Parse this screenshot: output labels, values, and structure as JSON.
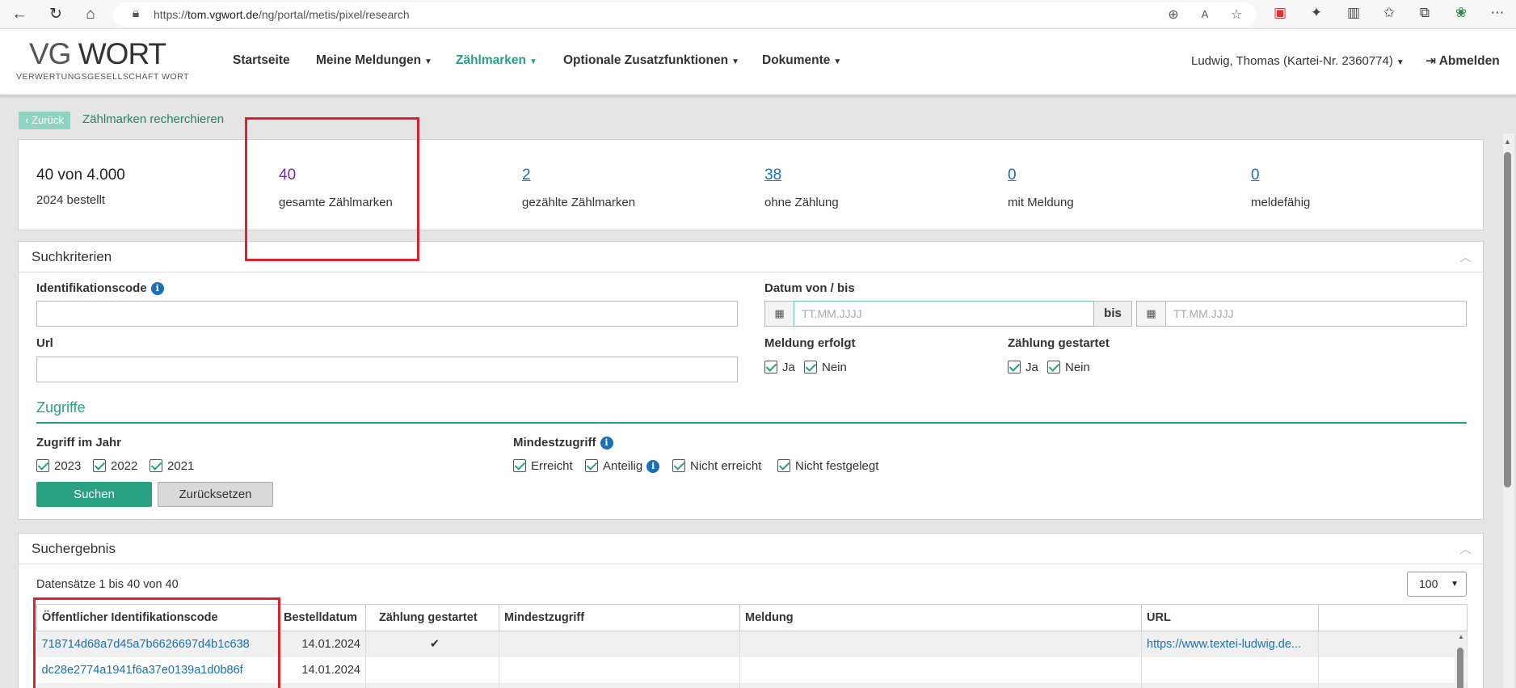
{
  "browser": {
    "url_prefix": "https://",
    "url_domain": "tom.vgwort.de",
    "url_path": "/ng/portal/metis/pixel/research"
  },
  "header": {
    "logo_vg": "VG",
    "logo_wort": "WORT",
    "logo_sub": "VERWERTUNGSGESELLSCHAFT WORT",
    "nav": [
      "Startseite",
      "Meine Meldungen",
      "Zählmarken",
      "Optionale Zusatzfunktionen",
      "Dokumente"
    ],
    "user": "Ludwig, Thomas (Kartei-Nr. 2360774)",
    "logout": "Abmelden"
  },
  "breadcrumb": {
    "back": "Zurück",
    "current": "Zählmarken recherchieren"
  },
  "stats": {
    "ordered_value": "40 von 4.000",
    "ordered_label": "2024 bestellt",
    "items": [
      {
        "value": "40",
        "label": "gesamte Zählmarken"
      },
      {
        "value": "2",
        "label": "gezählte Zählmarken"
      },
      {
        "value": "38",
        "label": "ohne Zählung"
      },
      {
        "value": "0",
        "label": "mit Meldung"
      },
      {
        "value": "0",
        "label": "meldefähig"
      }
    ]
  },
  "search": {
    "title": "Suchkriterien",
    "id_label": "Identifikationscode",
    "url_label": "Url",
    "date_label": "Datum von / bis",
    "date_placeholder_from": "TT.MM.JJJJ",
    "date_bis": "bis",
    "date_placeholder_to": "TT.MM.JJJJ",
    "meldung_label": "Meldung erfolgt",
    "meldung_options": [
      "Ja",
      "Nein"
    ],
    "zaehlung_label": "Zählung gestartet",
    "zaehlung_options": [
      "Ja",
      "Nein"
    ],
    "zugriffe_title": "Zugriffe",
    "zugriff_jahr_label": "Zugriff im Jahr",
    "years": [
      "2023",
      "2022",
      "2021"
    ],
    "mindest_label": "Mindestzugriff",
    "mindest_options": [
      "Erreicht",
      "Anteilig",
      "Nicht erreicht",
      "Nicht festgelegt"
    ],
    "search_button": "Suchen",
    "reset_button": "Zurücksetzen"
  },
  "results": {
    "title": "Suchergebnis",
    "count_text": "Datensätze 1 bis 40 von 40",
    "page_size": "100",
    "columns": [
      "Öffentlicher Identifikationscode",
      "Bestelldatum",
      "Zählung gestartet",
      "Mindestzugriff",
      "Meldung",
      "URL",
      ""
    ],
    "rows": [
      {
        "code": "718714d68a7d45a7b6626697d4b1c638",
        "date": "14.01.2024",
        "counted": "✔",
        "min": "",
        "meldung": "",
        "url": "https://www.textei-ludwig.de..."
      },
      {
        "code": "dc28e2774a1941f6a37e0139a1d0b86f",
        "date": "14.01.2024",
        "counted": "",
        "min": "",
        "meldung": "",
        "url": ""
      }
    ]
  }
}
